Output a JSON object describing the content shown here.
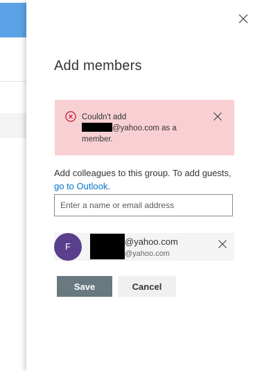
{
  "dialog": {
    "title": "Add members"
  },
  "error": {
    "line1": "Couldn't add",
    "line2_suffix": "@yahoo.com as a",
    "line3": "member."
  },
  "description": {
    "text": "Add colleagues to this group. To add guests, ",
    "link": "go to Outlook",
    "trailing": "."
  },
  "search": {
    "placeholder": "Enter a name or email address",
    "value": ""
  },
  "member": {
    "avatar_initial": "F",
    "name_suffix": "@yahoo.com",
    "email_suffix": "@yahoo.com"
  },
  "buttons": {
    "save": "Save",
    "cancel": "Cancel"
  },
  "colors": {
    "error_background": "#f8d0d4",
    "error_icon": "#c50f1f",
    "avatar": "#5a3f8c",
    "save_button": "#687a7f",
    "link": "#0072c6"
  },
  "icons": {
    "panel_close": "close-icon",
    "error": "error-circle-icon",
    "error_dismiss": "close-icon",
    "member_remove": "close-icon"
  }
}
